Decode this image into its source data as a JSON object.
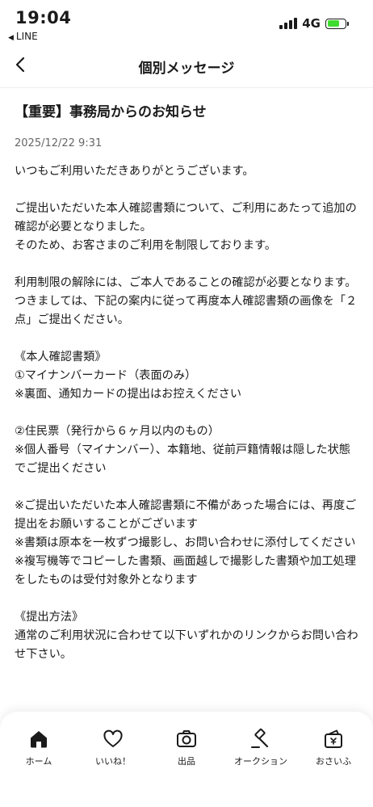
{
  "status_bar": {
    "time": "19:04",
    "back_app": "LINE",
    "network": "4G"
  },
  "header": {
    "title": "個別メッセージ"
  },
  "message": {
    "title": "【重要】事務局からのお知らせ",
    "date": "2025/12/22 9:31",
    "paragraphs": [
      [
        "いつもご利用いただきありがとうございます。"
      ],
      [
        "ご提出いただいた本人確認書類について、ご利用にあたって追加の確認が必要となりました。",
        "そのため、お客さまのご利用を制限しております。"
      ],
      [
        "利用制限の解除には、ご本人であることの確認が必要となります。",
        "つきましては、下記の案内に従って再度本人確認書類の画像を「２点」ご提出ください。"
      ],
      [
        "《本人確認書類》",
        "①マイナンバーカード（表面のみ）",
        "※裏面、通知カードの提出はお控えください"
      ],
      [
        "②住民票（発行から６ヶ月以内のもの）",
        "※個人番号（マイナンバー）、本籍地、従前戸籍情報は隠した状態でご提出ください"
      ],
      [
        "※ご提出いただいた本人確認書類に不備があった場合には、再度ご提出をお願いすることがございます",
        "※書類は原本を一枚ずつ撮影し、お問い合わせに添付してください",
        "※複写機等でコピーした書類、画面越しで撮影した書類や加工処理をしたものは受付対象外となります"
      ],
      [
        "《提出方法》",
        "通常のご利用状況に合わせて以下いずれかのリンクからお問い合わせ下さい。"
      ]
    ]
  },
  "tab_bar": {
    "items": [
      {
        "label": "ホーム",
        "icon": "home-icon"
      },
      {
        "label": "いいね！",
        "icon": "heart-icon"
      },
      {
        "label": "出品",
        "icon": "camera-icon"
      },
      {
        "label": "オークション",
        "icon": "auction-hammer-icon"
      },
      {
        "label": "おさいふ",
        "icon": "wallet-icon"
      }
    ]
  },
  "colors": {
    "text": "#1a1a1a",
    "muted": "#666666",
    "battery": "#3ddc2f"
  }
}
